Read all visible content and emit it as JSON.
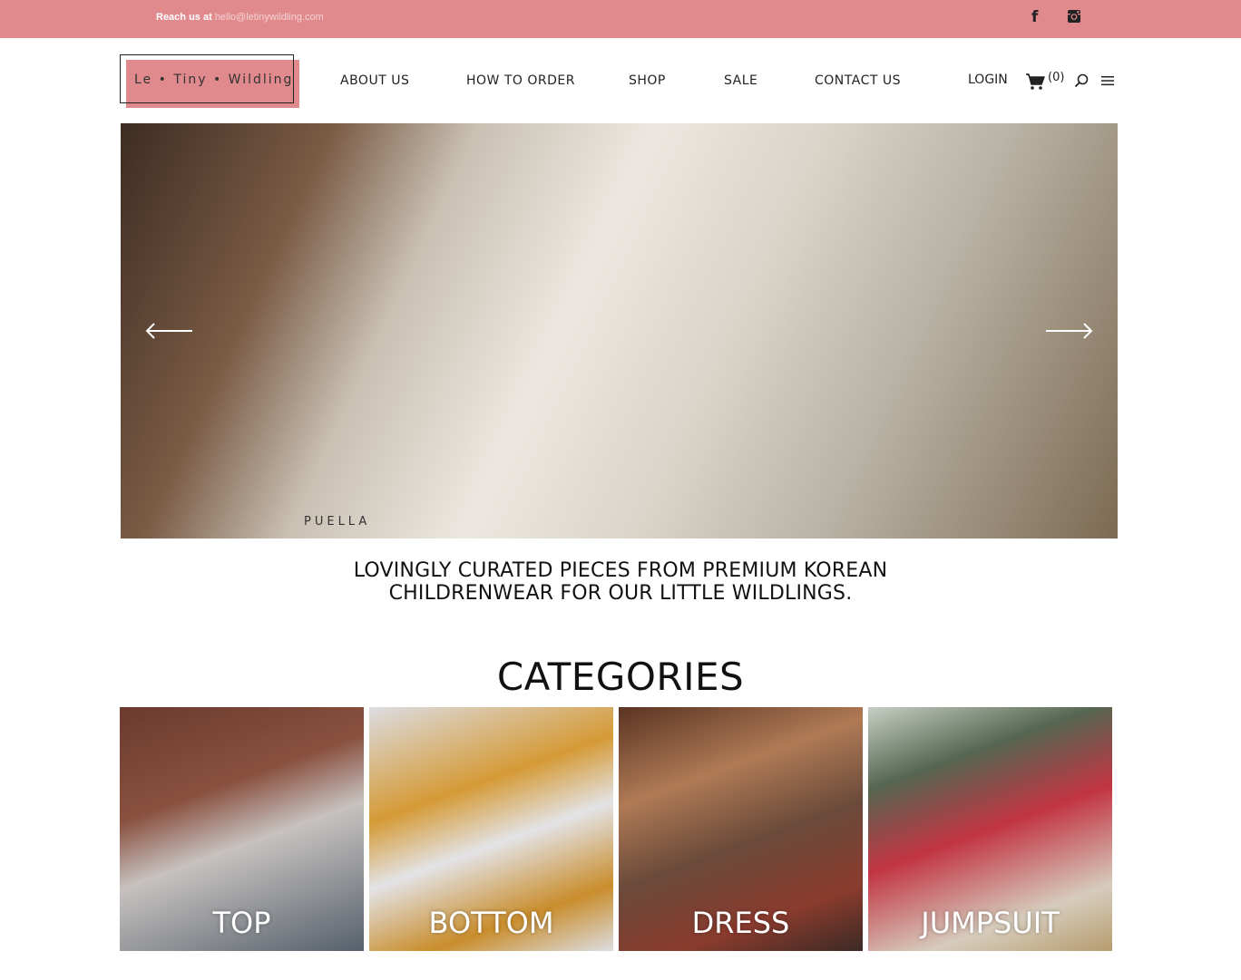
{
  "topbar": {
    "reach_label": "Reach us at",
    "email": "hello@letinywildling.com",
    "facebook_icon": "facebook-icon",
    "instagram_icon": "instagram-icon"
  },
  "header": {
    "logo_text": "Le • Tiny • Wildling",
    "nav": [
      "ABOUT US",
      "HOW TO ORDER",
      "SHOP",
      "SALE",
      "CONTACT US"
    ],
    "login": "LOGIN",
    "cart_count": "(0)"
  },
  "hero": {
    "watermark": "PUELLA"
  },
  "tagline": {
    "line1": "LOVINGLY CURATED PIECES FROM PREMIUM KOREAN",
    "line2": "CHILDRENWEAR FOR OUR LITTLE WILDLINGS."
  },
  "categories": {
    "title": "CATEGORIES",
    "items": [
      "TOP",
      "BOTTOM",
      "DRESS",
      "JUMPSUIT"
    ]
  },
  "colors": {
    "brand_pink": "#e08a8e"
  }
}
